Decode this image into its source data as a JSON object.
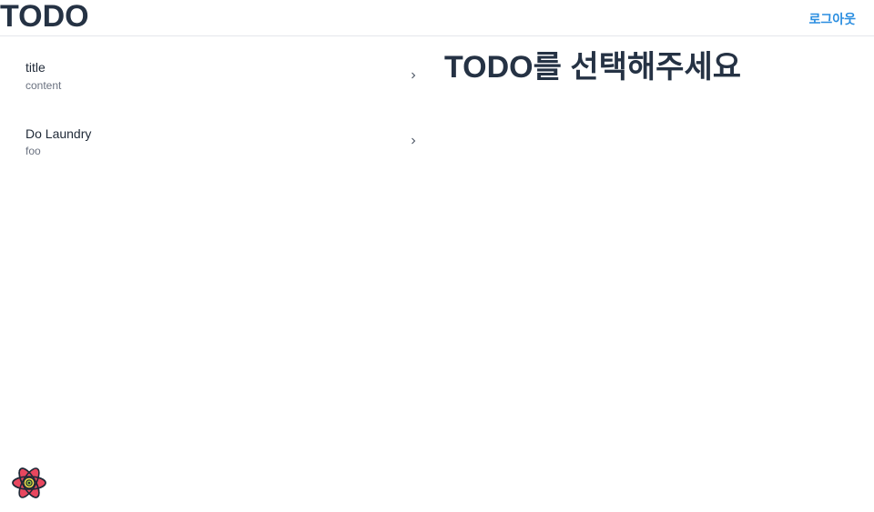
{
  "header": {
    "title": "TODO",
    "logout_label": "로그아웃"
  },
  "todos": [
    {
      "title": "title",
      "content": "content"
    },
    {
      "title": "Do Laundry",
      "content": "foo"
    }
  ],
  "main": {
    "placeholder_title": "TODO를 선택해주세요"
  },
  "colors": {
    "accent": "#2b8ee0",
    "title_text": "#253244",
    "muted_text": "#6b7280",
    "divider": "#e5e7eb"
  },
  "icons": {
    "chevron": "chevron-right-icon",
    "logo": "react-logo-icon"
  }
}
